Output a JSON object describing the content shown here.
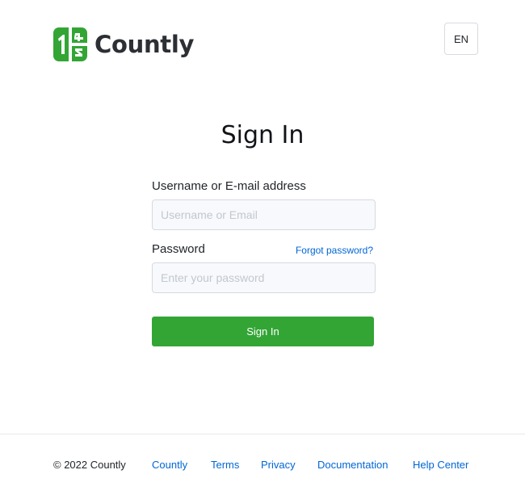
{
  "header": {
    "brand": "Countly",
    "language": "EN"
  },
  "form": {
    "title": "Sign In",
    "username_label": "Username or E-mail address",
    "username_placeholder": "Username or Email",
    "username_value": "",
    "password_label": "Password",
    "password_placeholder": "Enter your password",
    "password_value": "",
    "forgot_label": "Forgot password?",
    "submit_label": "Sign In"
  },
  "footer": {
    "copyright": "© 2022 Countly",
    "links": [
      "Countly",
      "Terms",
      "Privacy",
      "Documentation",
      "Help Center"
    ]
  },
  "colors": {
    "brand_green": "#33a535",
    "link_blue": "#0166d6"
  },
  "icons": {
    "logo": "countly-logo-icon"
  }
}
